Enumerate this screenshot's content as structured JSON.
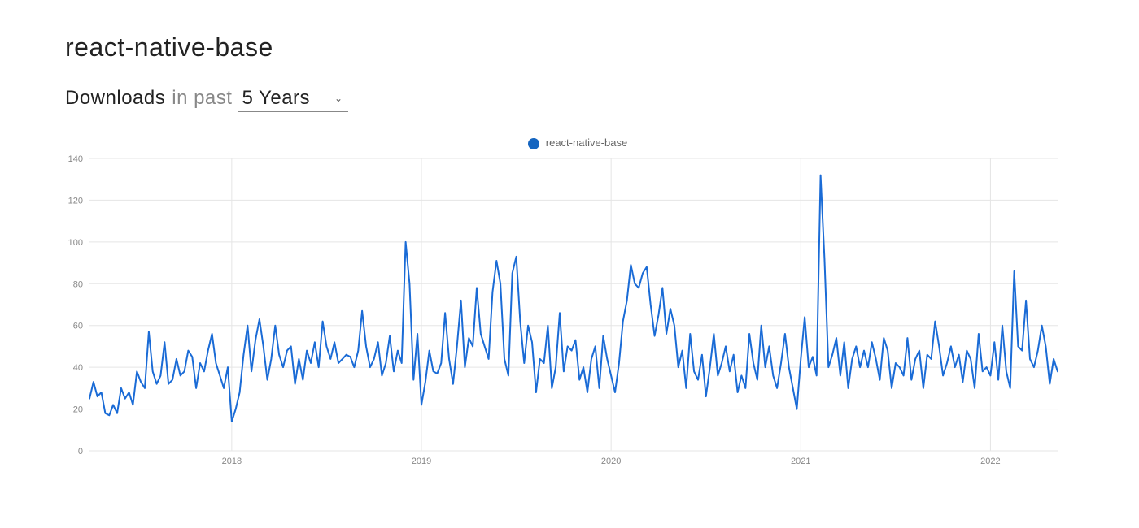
{
  "header": {
    "title": "react-native-base",
    "downloads_label": "Downloads",
    "in_past_label": "in past",
    "range_selected": "5 Years"
  },
  "legend": {
    "series_name": "react-native-base"
  },
  "chart_data": {
    "type": "line",
    "title": "",
    "xlabel": "",
    "ylabel": "",
    "ylim": [
      0,
      140
    ],
    "yticks": [
      0,
      20,
      40,
      60,
      80,
      100,
      120,
      140
    ],
    "xticks": [
      "2018",
      "2019",
      "2020",
      "2021",
      "2022"
    ],
    "x": [
      "2017-04",
      "2017-04",
      "2017-04",
      "2017-04",
      "2017-05",
      "2017-05",
      "2017-05",
      "2017-05",
      "2017-06",
      "2017-06",
      "2017-06",
      "2017-06",
      "2017-07",
      "2017-07",
      "2017-07",
      "2017-07",
      "2017-08",
      "2017-08",
      "2017-08",
      "2017-08",
      "2017-09",
      "2017-09",
      "2017-09",
      "2017-09",
      "2017-10",
      "2017-10",
      "2017-10",
      "2017-10",
      "2017-11",
      "2017-11",
      "2017-11",
      "2017-11",
      "2017-12",
      "2017-12",
      "2017-12",
      "2017-12",
      "2018-01",
      "2018-01",
      "2018-01",
      "2018-01",
      "2018-02",
      "2018-02",
      "2018-02",
      "2018-02",
      "2018-03",
      "2018-03",
      "2018-03",
      "2018-03",
      "2018-04",
      "2018-04",
      "2018-04",
      "2018-04",
      "2018-05",
      "2018-05",
      "2018-05",
      "2018-05",
      "2018-06",
      "2018-06",
      "2018-06",
      "2018-06",
      "2018-07",
      "2018-07",
      "2018-07",
      "2018-07",
      "2018-08",
      "2018-08",
      "2018-08",
      "2018-08",
      "2018-09",
      "2018-09",
      "2018-09",
      "2018-09",
      "2018-10",
      "2018-10",
      "2018-10",
      "2018-10",
      "2018-11",
      "2018-11",
      "2018-11",
      "2018-11",
      "2018-12",
      "2018-12",
      "2018-12",
      "2018-12",
      "2019-01",
      "2019-01",
      "2019-01",
      "2019-01",
      "2019-02",
      "2019-02",
      "2019-02",
      "2019-02",
      "2019-03",
      "2019-03",
      "2019-03",
      "2019-03",
      "2019-04",
      "2019-04",
      "2019-04",
      "2019-04",
      "2019-05",
      "2019-05",
      "2019-05",
      "2019-05",
      "2019-06",
      "2019-06",
      "2019-06",
      "2019-06",
      "2019-07",
      "2019-07",
      "2019-07",
      "2019-07",
      "2019-08",
      "2019-08",
      "2019-08",
      "2019-08",
      "2019-09",
      "2019-09",
      "2019-09",
      "2019-09",
      "2019-10",
      "2019-10",
      "2019-10",
      "2019-10",
      "2019-11",
      "2019-11",
      "2019-11",
      "2019-11",
      "2019-12",
      "2019-12",
      "2019-12",
      "2019-12",
      "2020-01",
      "2020-01",
      "2020-01",
      "2020-01",
      "2020-02",
      "2020-02",
      "2020-02",
      "2020-02",
      "2020-03",
      "2020-03",
      "2020-03",
      "2020-03",
      "2020-04",
      "2020-04",
      "2020-04",
      "2020-04",
      "2020-05",
      "2020-05",
      "2020-05",
      "2020-05",
      "2020-06",
      "2020-06",
      "2020-06",
      "2020-06",
      "2020-07",
      "2020-07",
      "2020-07",
      "2020-07",
      "2020-08",
      "2020-08",
      "2020-08",
      "2020-08",
      "2020-09",
      "2020-09",
      "2020-09",
      "2020-09",
      "2020-10",
      "2020-10",
      "2020-10",
      "2020-10",
      "2020-11",
      "2020-11",
      "2020-11",
      "2020-11",
      "2020-12",
      "2020-12",
      "2020-12",
      "2020-12",
      "2021-01",
      "2021-01",
      "2021-01",
      "2021-01",
      "2021-02",
      "2021-02",
      "2021-02",
      "2021-02",
      "2021-03",
      "2021-03",
      "2021-03",
      "2021-03",
      "2021-04",
      "2021-04",
      "2021-04",
      "2021-04",
      "2021-05",
      "2021-05",
      "2021-05",
      "2021-05",
      "2021-06",
      "2021-06",
      "2021-06",
      "2021-06",
      "2021-07",
      "2021-07",
      "2021-07",
      "2021-07",
      "2021-08",
      "2021-08",
      "2021-08",
      "2021-08",
      "2021-09",
      "2021-09",
      "2021-09",
      "2021-09",
      "2021-10",
      "2021-10",
      "2021-10",
      "2021-10",
      "2021-11",
      "2021-11",
      "2021-11",
      "2021-11",
      "2021-12",
      "2021-12",
      "2021-12",
      "2021-12",
      "2022-01",
      "2022-01",
      "2022-01",
      "2022-01",
      "2022-02",
      "2022-02",
      "2022-02",
      "2022-02",
      "2022-03",
      "2022-03",
      "2022-03",
      "2022-03",
      "2022-04",
      "2022-04",
      "2022-04",
      "2022-04",
      "2022-05",
      "2022-05"
    ],
    "series": [
      {
        "name": "react-native-base",
        "color": "#1a6bd6",
        "values": [
          25,
          33,
          26,
          28,
          18,
          17,
          22,
          18,
          30,
          25,
          28,
          22,
          38,
          33,
          30,
          57,
          38,
          32,
          36,
          52,
          32,
          34,
          44,
          36,
          38,
          48,
          45,
          30,
          42,
          38,
          48,
          56,
          42,
          36,
          30,
          40,
          14,
          20,
          28,
          46,
          60,
          38,
          53,
          63,
          50,
          34,
          44,
          60,
          46,
          40,
          48,
          50,
          32,
          44,
          34,
          48,
          42,
          52,
          40,
          62,
          50,
          44,
          52,
          42,
          44,
          46,
          45,
          40,
          48,
          67,
          50,
          40,
          44,
          52,
          36,
          42,
          55,
          38,
          48,
          42,
          100,
          80,
          34,
          56,
          22,
          33,
          48,
          38,
          37,
          42,
          66,
          44,
          32,
          50,
          72,
          40,
          54,
          50,
          78,
          56,
          50,
          44,
          76,
          91,
          80,
          44,
          36,
          85,
          93,
          62,
          42,
          60,
          52,
          28,
          44,
          42,
          60,
          30,
          40,
          66,
          38,
          50,
          48,
          53,
          34,
          40,
          28,
          44,
          50,
          30,
          55,
          44,
          36,
          28,
          42,
          62,
          72,
          89,
          80,
          78,
          85,
          88,
          70,
          55,
          65,
          78,
          56,
          68,
          60,
          40,
          48,
          30,
          56,
          38,
          34,
          46,
          26,
          40,
          56,
          36,
          42,
          50,
          38,
          46,
          28,
          36,
          30,
          56,
          42,
          34,
          60,
          40,
          50,
          36,
          30,
          42,
          56,
          40,
          30,
          20,
          44,
          64,
          40,
          45,
          36,
          132,
          92,
          40,
          46,
          54,
          36,
          52,
          30,
          44,
          50,
          40,
          48,
          40,
          52,
          44,
          34,
          54,
          48,
          30,
          42,
          40,
          36,
          54,
          34,
          44,
          48,
          30,
          46,
          44,
          62,
          50,
          36,
          42,
          50,
          40,
          46,
          33,
          48,
          44,
          30,
          56,
          38,
          40,
          36,
          52,
          34,
          60,
          38,
          30,
          86,
          50,
          48,
          72,
          44,
          40,
          48,
          60,
          50,
          32,
          44,
          38
        ]
      }
    ]
  }
}
